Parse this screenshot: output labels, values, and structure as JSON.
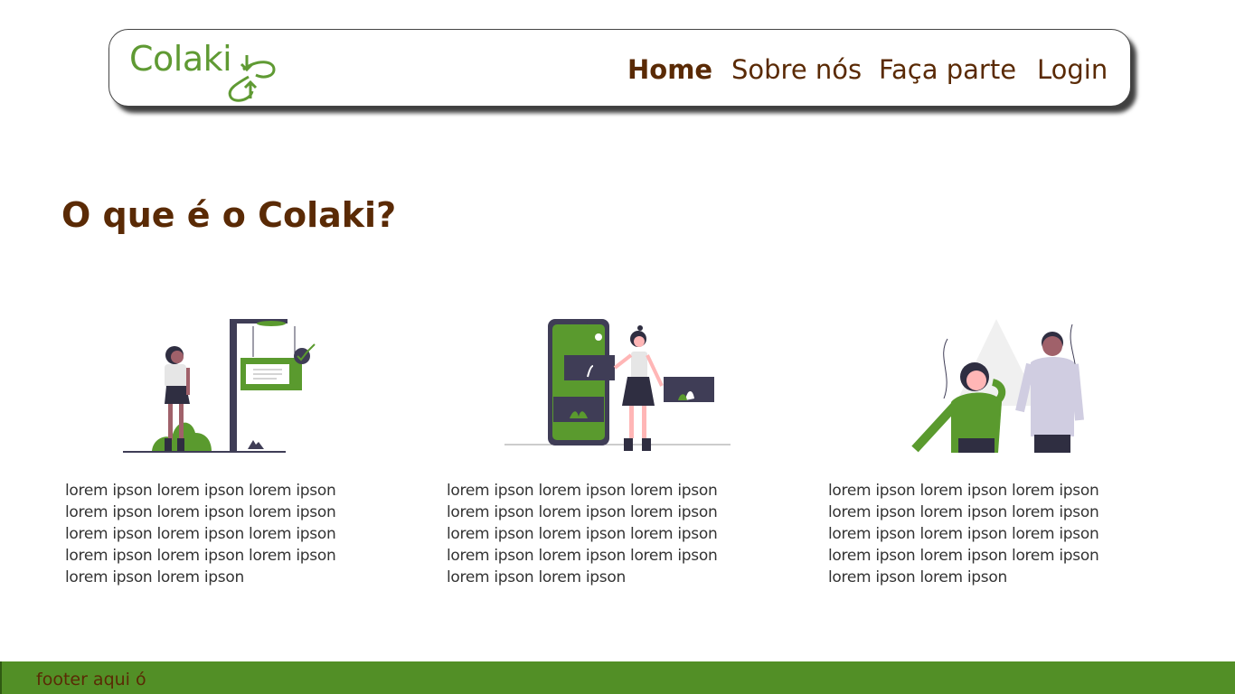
{
  "brand": {
    "name": "Colaki",
    "color": "#5f9a33"
  },
  "nav": {
    "items": [
      {
        "label": "Home",
        "active": true
      },
      {
        "label": "Sobre nós",
        "active": false
      },
      {
        "label": "Faça parte",
        "active": false
      },
      {
        "label": "Login",
        "active": false
      }
    ],
    "text_color": "#5a2a05"
  },
  "main": {
    "title": "O que é o Colaki?",
    "cards": [
      {
        "illustration": "woman-at-signpost-illustration",
        "text": "lorem ipson lorem ipson lorem ipson lorem ipson lorem ipson lorem ipson lorem ipson lorem ipson lorem ipson lorem ipson lorem ipson lorem ipson lorem ipson lorem ipson"
      },
      {
        "illustration": "woman-with-phone-illustration",
        "text": "lorem ipson lorem ipson lorem ipson lorem ipson lorem ipson lorem ipson lorem ipson lorem ipson lorem ipson lorem ipson lorem ipson lorem ipson lorem ipson lorem ipson"
      },
      {
        "illustration": "two-people-illustration",
        "text": "lorem ipson lorem ipson lorem ipson lorem ipson lorem ipson lorem ipson lorem ipson lorem ipson lorem ipson lorem ipson lorem ipson lorem ipson lorem ipson lorem ipson"
      }
    ]
  },
  "footer": {
    "text": "footer aqui ó",
    "color": "#528f26"
  }
}
